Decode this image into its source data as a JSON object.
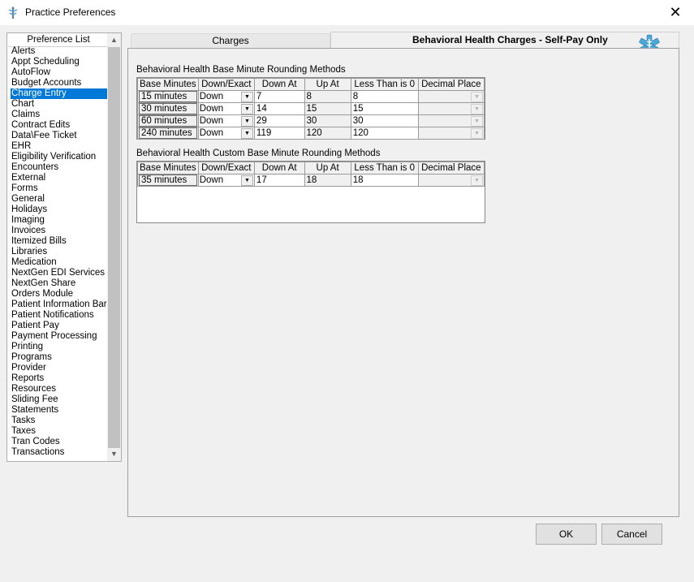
{
  "window": {
    "title": "Practice Preferences",
    "close_glyph": "✕"
  },
  "preference_list": {
    "header": "Preference List",
    "items": [
      "Alerts",
      "Appt Scheduling",
      "AutoFlow",
      "Budget Accounts",
      "Charge Entry",
      "Chart",
      "Claims",
      "Contract Edits",
      "Data\\Fee Ticket",
      "EHR",
      "Eligibility Verification",
      "Encounters",
      "External",
      "Forms",
      "General",
      "Holidays",
      "Imaging",
      "Invoices",
      "Itemized Bills",
      "Libraries",
      "Medication",
      "NextGen EDI Services",
      "NextGen Share",
      "Orders Module",
      "Patient Information Bar",
      "Patient Notifications",
      "Patient Pay",
      "Payment Processing",
      "Printing",
      "Programs",
      "Provider",
      "Reports",
      "Resources",
      "Sliding Fee",
      "Statements",
      "Tasks",
      "Taxes",
      "Tran Codes",
      "Transactions"
    ],
    "selected": "Charge Entry",
    "scroll_up_glyph": "▲",
    "scroll_down_glyph": "▼"
  },
  "tabs": {
    "charges": "Charges",
    "active": "Behavioral Health Charges - Self-Pay Only"
  },
  "base_section": {
    "title": "Behavioral Health Base Minute Rounding Methods",
    "columns": [
      "Base Minutes",
      "Down/Exact",
      "Down At",
      "Up At",
      "Less Than is 0",
      "Decimal Place"
    ],
    "rows": [
      {
        "base": "15 minutes",
        "mode": "Down",
        "down_at": "7",
        "up_at": "8",
        "less_than": "8",
        "decimal": ""
      },
      {
        "base": "30 minutes",
        "mode": "Down",
        "down_at": "14",
        "up_at": "15",
        "less_than": "15",
        "decimal": ""
      },
      {
        "base": "60 minutes",
        "mode": "Down",
        "down_at": "29",
        "up_at": "30",
        "less_than": "30",
        "decimal": ""
      },
      {
        "base": "240 minutes",
        "mode": "Down",
        "down_at": "119",
        "up_at": "120",
        "less_than": "120",
        "decimal": ""
      }
    ]
  },
  "custom_section": {
    "title": "Behavioral Health Custom Base Minute Rounding Methods",
    "columns": [
      "Base Minutes",
      "Down/Exact",
      "Down At",
      "Up At",
      "Less Than is 0",
      "Decimal Place"
    ],
    "rows": [
      {
        "base": "35 minutes",
        "mode": "Down",
        "down_at": "17",
        "up_at": "18",
        "less_than": "18",
        "decimal": ""
      }
    ]
  },
  "dropdown_glyph": "▼",
  "buttons": {
    "ok": "OK",
    "cancel": "Cancel"
  },
  "icons": {
    "app": "caduceus-icon",
    "tab": "star-of-life-icon"
  }
}
